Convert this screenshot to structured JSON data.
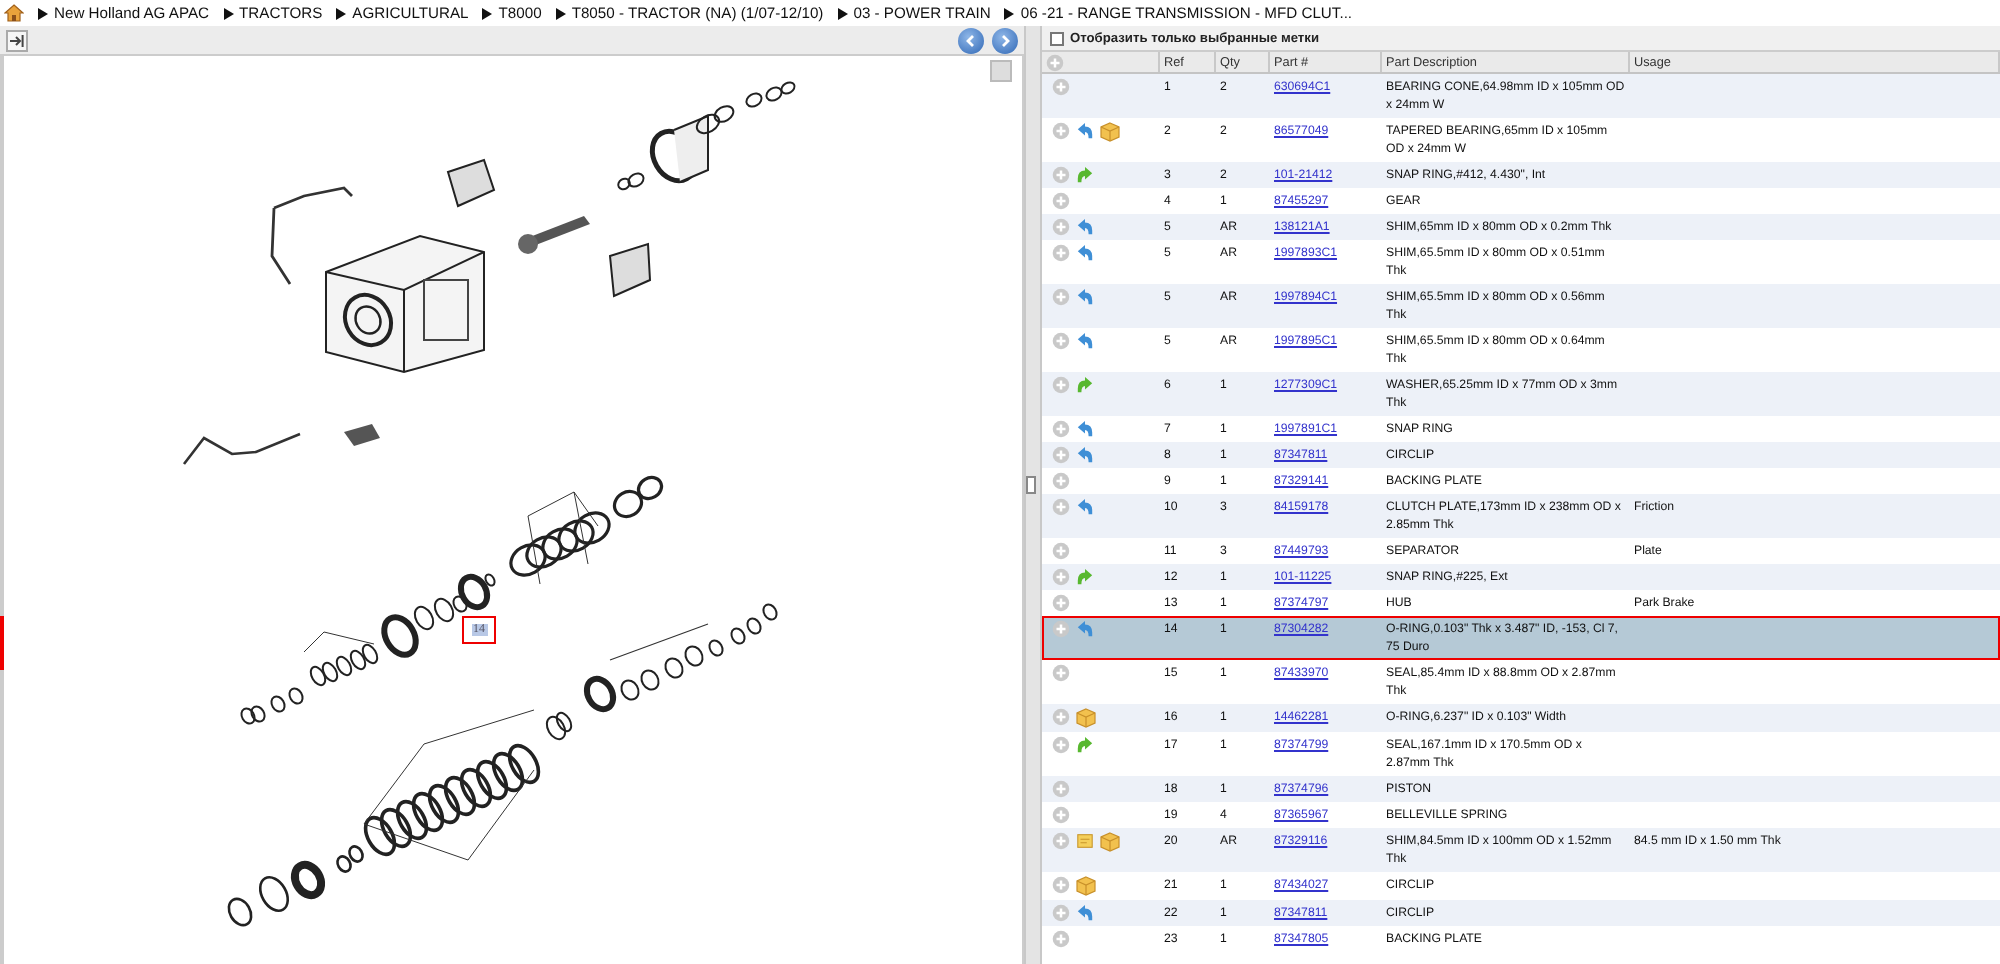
{
  "breadcrumb": [
    "New Holland AG APAC",
    "TRACTORS",
    "AGRICULTURAL",
    "T8000",
    "T8050 - TRACTOR (NA) (1/07-12/10)",
    "03 - POWER TRAIN",
    "06 -21 - RANGE TRANSMISSION - MFD CLUT..."
  ],
  "diagram": {
    "selected_callout": "14"
  },
  "filter": {
    "label": "Отобразить только выбранные метки",
    "checked": false
  },
  "table": {
    "columns": [
      "Ref",
      "Qty",
      "Part #",
      "Part Description",
      "Usage"
    ],
    "rows": [
      {
        "note": false,
        "back": false,
        "forward": false,
        "box": false,
        "ref": "1",
        "qty": "2",
        "part": "630694C1",
        "description": "BEARING CONE,64.98mm ID x 105mm OD x 24mm W",
        "selected": false
      },
      {
        "note": false,
        "back": true,
        "forward": false,
        "box": true,
        "ref": "2",
        "qty": "2",
        "part": "86577049",
        "description": "TAPERED BEARING,65mm ID x 105mm OD x 24mm W",
        "selected": false
      },
      {
        "note": false,
        "back": false,
        "forward": true,
        "box": false,
        "ref": "3",
        "qty": "2",
        "part": "101-21412",
        "description": "SNAP RING,#412, 4.430\", Int",
        "selected": false
      },
      {
        "note": false,
        "back": false,
        "forward": false,
        "box": false,
        "ref": "4",
        "qty": "1",
        "part": "87455297",
        "description": "GEAR",
        "selected": false
      },
      {
        "note": false,
        "back": true,
        "forward": false,
        "box": false,
        "ref": "5",
        "qty": "AR",
        "part": "138121A1",
        "description": "SHIM,65mm ID x 80mm OD x 0.2mm Thk",
        "selected": false
      },
      {
        "note": false,
        "back": true,
        "forward": false,
        "box": false,
        "ref": "5",
        "qty": "AR",
        "part": "1997893C1",
        "description": "SHIM,65.5mm ID x 80mm OD x 0.51mm Thk",
        "selected": false
      },
      {
        "note": false,
        "back": true,
        "forward": false,
        "box": false,
        "ref": "5",
        "qty": "AR",
        "part": "1997894C1",
        "description": "SHIM,65.5mm ID x 80mm OD x 0.56mm Thk",
        "selected": false
      },
      {
        "note": false,
        "back": true,
        "forward": false,
        "box": false,
        "ref": "5",
        "qty": "AR",
        "part": "1997895C1",
        "description": "SHIM,65.5mm ID x 80mm OD x 0.64mm Thk",
        "selected": false
      },
      {
        "note": false,
        "back": false,
        "forward": true,
        "box": false,
        "ref": "6",
        "qty": "1",
        "part": "1277309C1",
        "description": "WASHER,65.25mm ID x 77mm OD x 3mm Thk",
        "selected": false
      },
      {
        "note": false,
        "back": true,
        "forward": false,
        "box": false,
        "ref": "7",
        "qty": "1",
        "part": "1997891C1",
        "description": "SNAP RING",
        "selected": false
      },
      {
        "note": false,
        "back": true,
        "forward": false,
        "box": false,
        "ref": "8",
        "qty": "1",
        "part": "87347811",
        "description": "CIRCLIP",
        "selected": false
      },
      {
        "note": false,
        "back": false,
        "forward": false,
        "box": false,
        "ref": "9",
        "qty": "1",
        "part": "87329141",
        "description": "BACKING PLATE",
        "selected": false
      },
      {
        "note": false,
        "back": true,
        "forward": false,
        "box": false,
        "ref": "10",
        "qty": "3",
        "part": "84159178",
        "description": "CLUTCH PLATE,173mm ID x 238mm OD x 2.85mm Thk",
        "usage": "Friction",
        "selected": false
      },
      {
        "note": false,
        "back": false,
        "forward": false,
        "box": false,
        "ref": "11",
        "qty": "3",
        "part": "87449793",
        "description": "SEPARATOR",
        "usage": "Plate",
        "selected": false
      },
      {
        "note": false,
        "back": false,
        "forward": true,
        "box": false,
        "ref": "12",
        "qty": "1",
        "part": "101-11225",
        "description": "SNAP RING,#225, Ext",
        "selected": false
      },
      {
        "note": false,
        "back": false,
        "forward": false,
        "box": false,
        "ref": "13",
        "qty": "1",
        "part": "87374797",
        "description": "HUB",
        "usage": "Park Brake",
        "selected": false
      },
      {
        "note": false,
        "back": true,
        "forward": false,
        "box": false,
        "ref": "14",
        "qty": "1",
        "part": "87304282",
        "description": "O-RING,0.103\" Thk x 3.487\" ID, -153, Cl 7, 75 Duro",
        "selected": true
      },
      {
        "note": false,
        "back": false,
        "forward": false,
        "box": false,
        "ref": "15",
        "qty": "1",
        "part": "87433970",
        "description": "SEAL,85.4mm ID x 88.8mm OD x 2.87mm Thk",
        "selected": false
      },
      {
        "note": false,
        "back": false,
        "forward": false,
        "box": true,
        "ref": "16",
        "qty": "1",
        "part": "14462281",
        "description": "O-RING,6.237\" ID x 0.103\" Width",
        "selected": false
      },
      {
        "note": false,
        "back": false,
        "forward": true,
        "box": false,
        "ref": "17",
        "qty": "1",
        "part": "87374799",
        "description": "SEAL,167.1mm ID x 170.5mm OD x 2.87mm Thk",
        "selected": false
      },
      {
        "note": false,
        "back": false,
        "forward": false,
        "box": false,
        "ref": "18",
        "qty": "1",
        "part": "87374796",
        "description": "PISTON",
        "selected": false
      },
      {
        "note": false,
        "back": false,
        "forward": false,
        "box": false,
        "ref": "19",
        "qty": "4",
        "part": "87365967",
        "description": "BELLEVILLE SPRING",
        "selected": false
      },
      {
        "note": true,
        "back": false,
        "forward": false,
        "box": true,
        "ref": "20",
        "qty": "AR",
        "part": "87329116",
        "description": "SHIM,84.5mm ID x 100mm OD x 1.52mm Thk",
        "usage": "84.5 mm ID x 1.50 mm Thk",
        "selected": false
      },
      {
        "note": false,
        "back": false,
        "forward": false,
        "box": true,
        "ref": "21",
        "qty": "1",
        "part": "87434027",
        "description": "CIRCLIP",
        "selected": false
      },
      {
        "note": false,
        "back": true,
        "forward": false,
        "box": false,
        "ref": "22",
        "qty": "1",
        "part": "87347811",
        "description": "CIRCLIP",
        "selected": false
      },
      {
        "note": false,
        "back": false,
        "forward": false,
        "box": false,
        "ref": "23",
        "qty": "1",
        "part": "87347805",
        "description": "BACKING PLATE",
        "selected": false
      }
    ]
  }
}
